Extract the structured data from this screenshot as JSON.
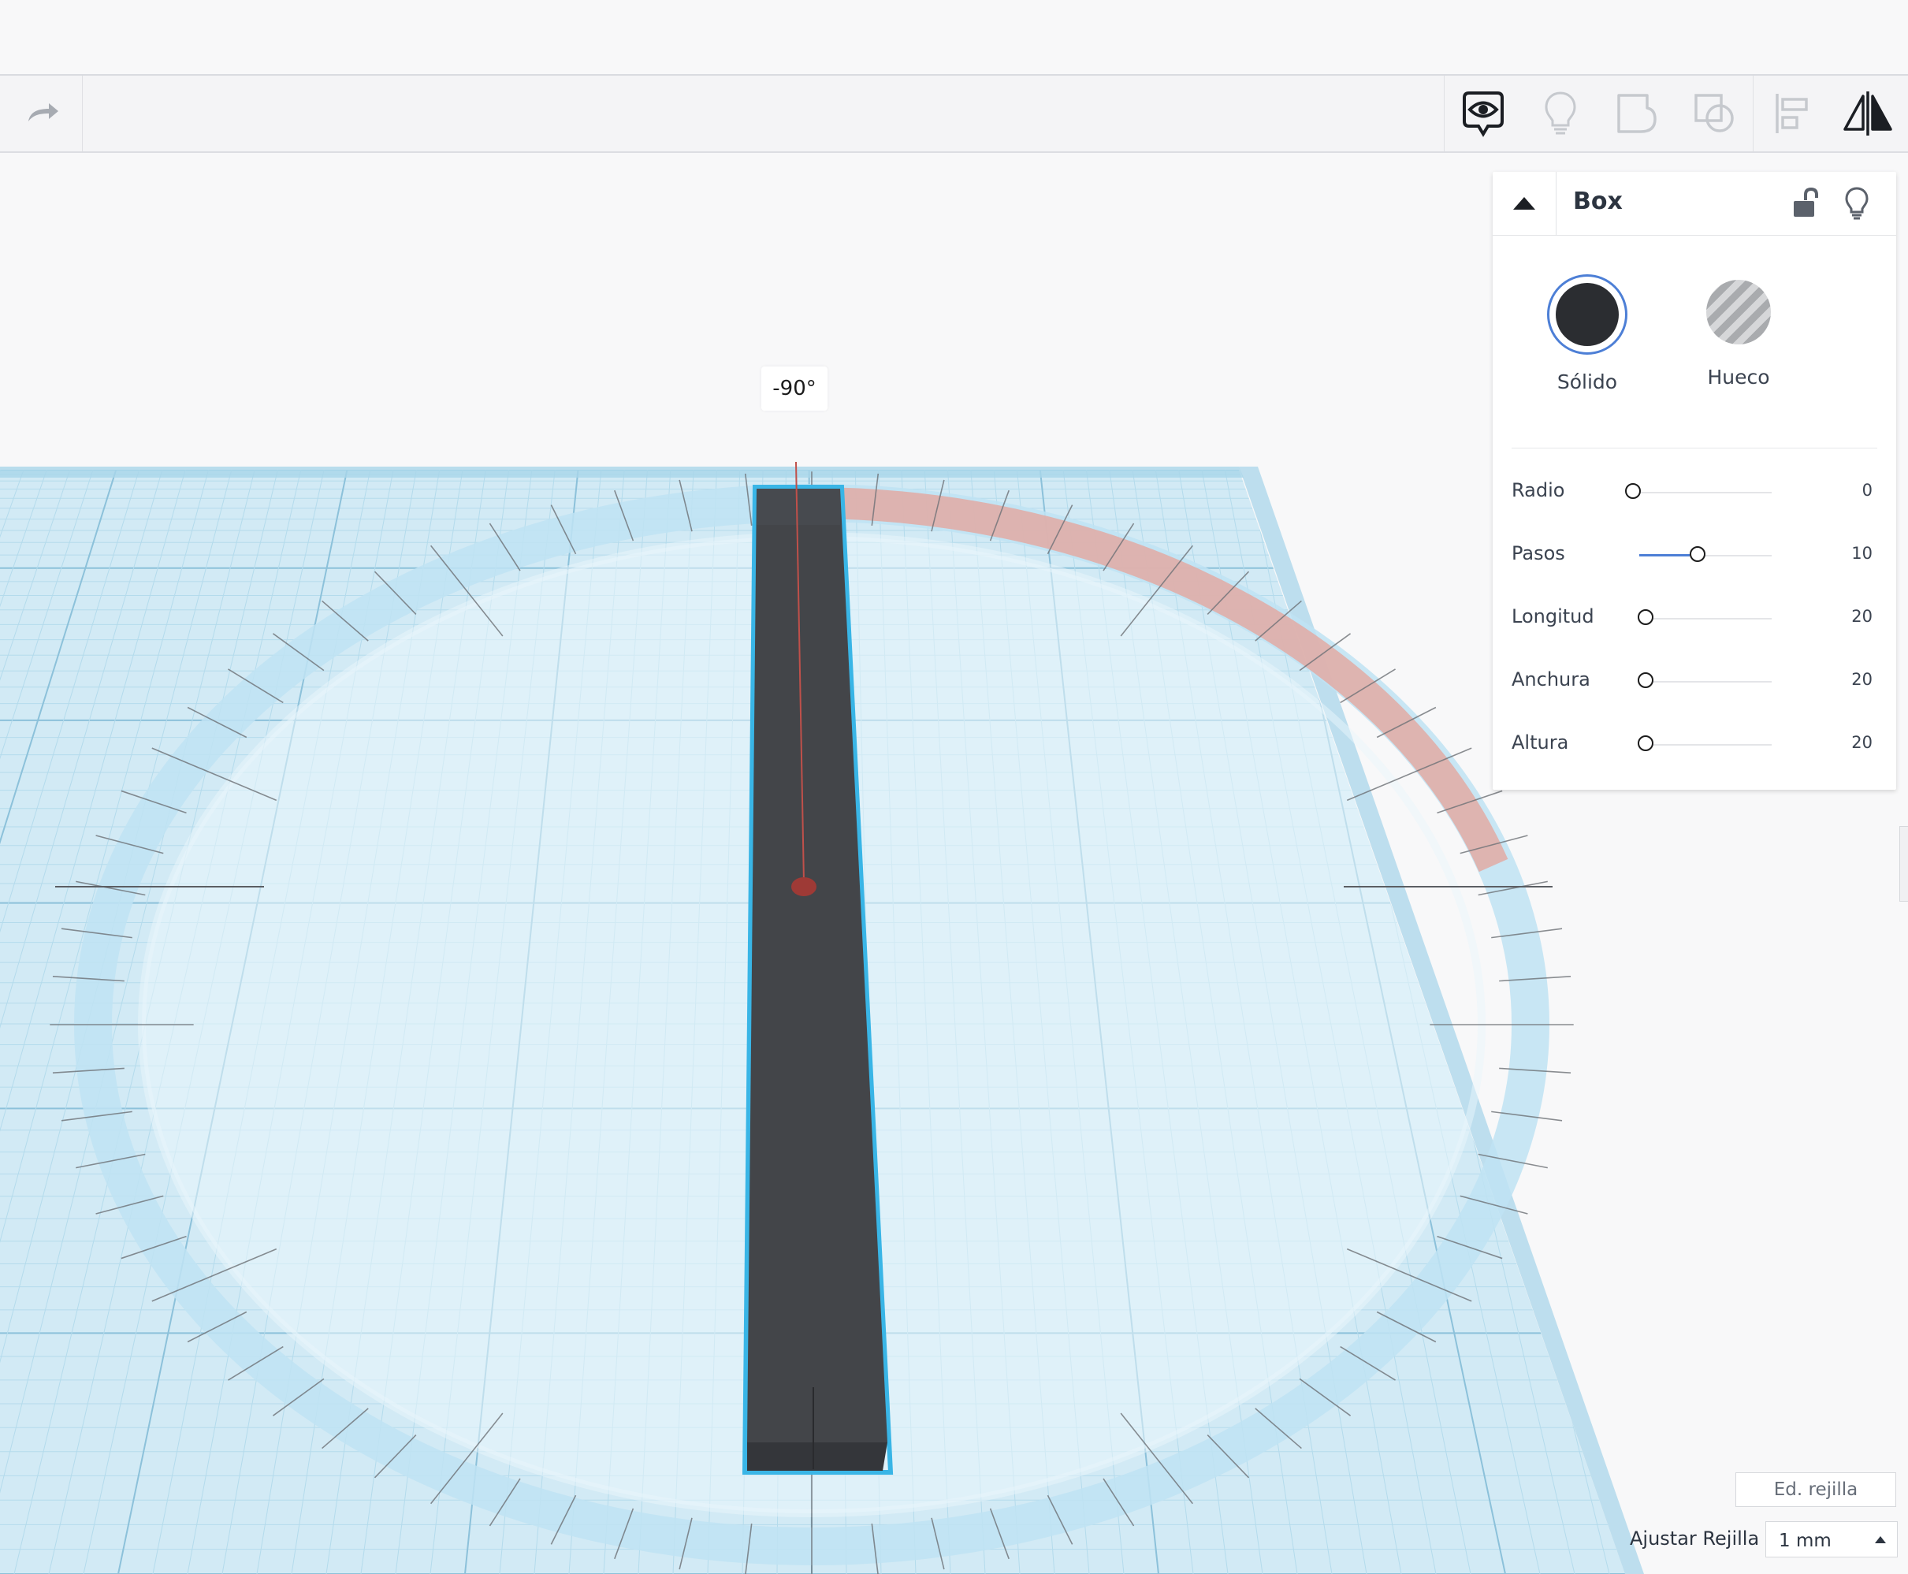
{
  "workplane": {
    "angle_label": "-90°"
  },
  "inspector": {
    "title": "Box",
    "modes": [
      {
        "label": "Sólido",
        "selected": true
      },
      {
        "label": "Hueco",
        "selected": false
      }
    ],
    "properties": [
      {
        "name": "Radio",
        "value": "0",
        "level": 0
      },
      {
        "name": "Pasos",
        "value": "10",
        "level": 0.37
      },
      {
        "name": "Longitud",
        "value": "20",
        "level": 0.07
      },
      {
        "name": "Anchura",
        "value": "20",
        "level": 0.07
      },
      {
        "name": "Altura",
        "value": "20",
        "level": 0.07
      }
    ]
  },
  "grid": {
    "edit_label": "Ed. rejilla",
    "snap_label": "Ajustar Rejilla",
    "snap_value": "1 mm"
  },
  "colors": {
    "grid_fill": "#cfe8f3",
    "grid_line": "#9ccbe0",
    "ring": "#bfe3f3",
    "ring_active": "#e2aaa3",
    "box": "#434549",
    "selection": "#39b5e6",
    "accent": "#4d7fd6"
  }
}
